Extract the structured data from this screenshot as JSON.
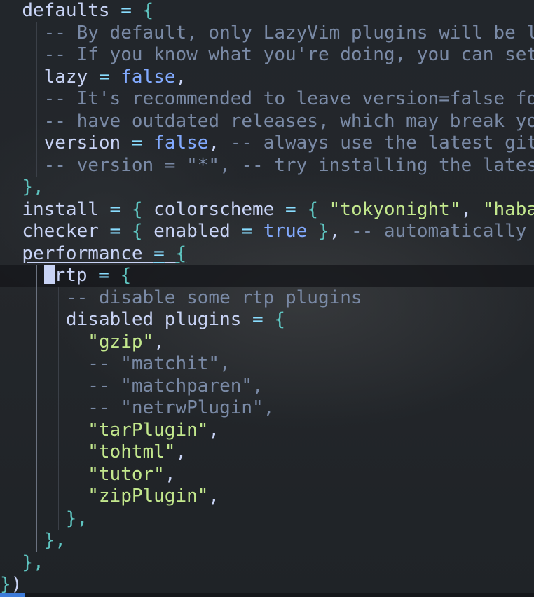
{
  "editor": {
    "language": "lua",
    "lines": [
      [
        {
          "t": "  "
        },
        {
          "t": "defaults",
          "c": "k"
        },
        {
          "t": " "
        },
        {
          "t": "=",
          "c": "op"
        },
        {
          "t": " "
        },
        {
          "t": "{",
          "c": "b"
        }
      ],
      [
        {
          "t": "    "
        },
        {
          "t": "-- By default, only LazyVim plugins will be l",
          "c": "c"
        }
      ],
      [
        {
          "t": "    "
        },
        {
          "t": "-- If you know what you're doing, you can set",
          "c": "c"
        }
      ],
      [
        {
          "t": "    "
        },
        {
          "t": "lazy",
          "c": "k"
        },
        {
          "t": " "
        },
        {
          "t": "=",
          "c": "op"
        },
        {
          "t": " "
        },
        {
          "t": "false",
          "c": "bool"
        },
        {
          "t": ",",
          "c": "k"
        }
      ],
      [
        {
          "t": "    "
        },
        {
          "t": "-- It's recommended to leave version=false fo",
          "c": "c"
        }
      ],
      [
        {
          "t": "    "
        },
        {
          "t": "-- have outdated releases, which may break yo",
          "c": "c"
        }
      ],
      [
        {
          "t": "    "
        },
        {
          "t": "version",
          "c": "k"
        },
        {
          "t": " "
        },
        {
          "t": "=",
          "c": "op"
        },
        {
          "t": " "
        },
        {
          "t": "false",
          "c": "bool"
        },
        {
          "t": ",",
          "c": "k"
        },
        {
          "t": " "
        },
        {
          "t": "-- always use the latest git",
          "c": "c"
        }
      ],
      [
        {
          "t": "    "
        },
        {
          "t": "-- version = \"*\", -- try installing the lates",
          "c": "c"
        }
      ],
      [
        {
          "t": "  "
        },
        {
          "t": "},",
          "c": "b"
        }
      ],
      [
        {
          "t": "  "
        },
        {
          "t": "install",
          "c": "k"
        },
        {
          "t": " "
        },
        {
          "t": "=",
          "c": "op"
        },
        {
          "t": " "
        },
        {
          "t": "{",
          "c": "b"
        },
        {
          "t": " "
        },
        {
          "t": "colorscheme",
          "c": "k"
        },
        {
          "t": " "
        },
        {
          "t": "=",
          "c": "op"
        },
        {
          "t": " "
        },
        {
          "t": "{",
          "c": "b"
        },
        {
          "t": " "
        },
        {
          "t": "\"tokyonight\"",
          "c": "str"
        },
        {
          "t": ",",
          "c": "k"
        },
        {
          "t": " "
        },
        {
          "t": "\"haba",
          "c": "str"
        }
      ],
      [
        {
          "t": "  "
        },
        {
          "t": "checker",
          "c": "k"
        },
        {
          "t": " "
        },
        {
          "t": "=",
          "c": "op"
        },
        {
          "t": " "
        },
        {
          "t": "{",
          "c": "b"
        },
        {
          "t": " "
        },
        {
          "t": "enabled",
          "c": "k"
        },
        {
          "t": " "
        },
        {
          "t": "=",
          "c": "op"
        },
        {
          "t": " "
        },
        {
          "t": "true",
          "c": "bool"
        },
        {
          "t": " "
        },
        {
          "t": "}",
          "c": "b"
        },
        {
          "t": ",",
          "c": "k"
        },
        {
          "t": " "
        },
        {
          "t": "-- automatically",
          "c": "c"
        }
      ],
      [
        {
          "t": "  "
        },
        {
          "t": "performance",
          "c": "k",
          "u": true
        },
        {
          "t": " ",
          "u": true
        },
        {
          "t": "=",
          "c": "op",
          "u": true
        },
        {
          "t": " ",
          "u": true
        },
        {
          "t": "{",
          "c": "b",
          "u": true
        }
      ],
      [
        {
          "t": "    "
        },
        {
          "t": "",
          "cursor": true
        },
        {
          "t": "rtp",
          "c": "k"
        },
        {
          "t": " "
        },
        {
          "t": "=",
          "c": "op"
        },
        {
          "t": " "
        },
        {
          "t": "{",
          "c": "b"
        }
      ],
      [
        {
          "t": "      "
        },
        {
          "t": "-- disable some rtp plugins",
          "c": "c"
        }
      ],
      [
        {
          "t": "      "
        },
        {
          "t": "disabled_plugins",
          "c": "k"
        },
        {
          "t": " "
        },
        {
          "t": "=",
          "c": "op"
        },
        {
          "t": " "
        },
        {
          "t": "{",
          "c": "b"
        }
      ],
      [
        {
          "t": "        "
        },
        {
          "t": "\"gzip\"",
          "c": "str"
        },
        {
          "t": ",",
          "c": "k"
        }
      ],
      [
        {
          "t": "        "
        },
        {
          "t": "-- \"matchit\",",
          "c": "c"
        }
      ],
      [
        {
          "t": "        "
        },
        {
          "t": "-- \"matchparen\",",
          "c": "c"
        }
      ],
      [
        {
          "t": "        "
        },
        {
          "t": "-- \"netrwPlugin\",",
          "c": "c"
        }
      ],
      [
        {
          "t": "        "
        },
        {
          "t": "\"tarPlugin\"",
          "c": "str"
        },
        {
          "t": ",",
          "c": "k"
        }
      ],
      [
        {
          "t": "        "
        },
        {
          "t": "\"tohtml\"",
          "c": "str"
        },
        {
          "t": ",",
          "c": "k"
        }
      ],
      [
        {
          "t": "        "
        },
        {
          "t": "\"tutor\"",
          "c": "str"
        },
        {
          "t": ",",
          "c": "k"
        }
      ],
      [
        {
          "t": "        "
        },
        {
          "t": "\"zipPlugin\"",
          "c": "str"
        },
        {
          "t": ",",
          "c": "k"
        }
      ],
      [
        {
          "t": "      "
        },
        {
          "t": "},",
          "c": "b"
        }
      ],
      [
        {
          "t": "    "
        },
        {
          "t": "},",
          "c": "b"
        }
      ],
      [
        {
          "t": "  "
        },
        {
          "t": "},",
          "c": "b"
        }
      ],
      [
        {
          "t": "}",
          "c": "b"
        },
        {
          "t": ")",
          "c": "k"
        }
      ]
    ]
  },
  "colors": {
    "background": "#22262b",
    "comment": "#7a8aa6",
    "string": "#c3e88d",
    "keyword": "#c8d3f5",
    "boolean": "#82aaff",
    "bracket": "#5ec4c0",
    "cursorline": "#15171b"
  }
}
